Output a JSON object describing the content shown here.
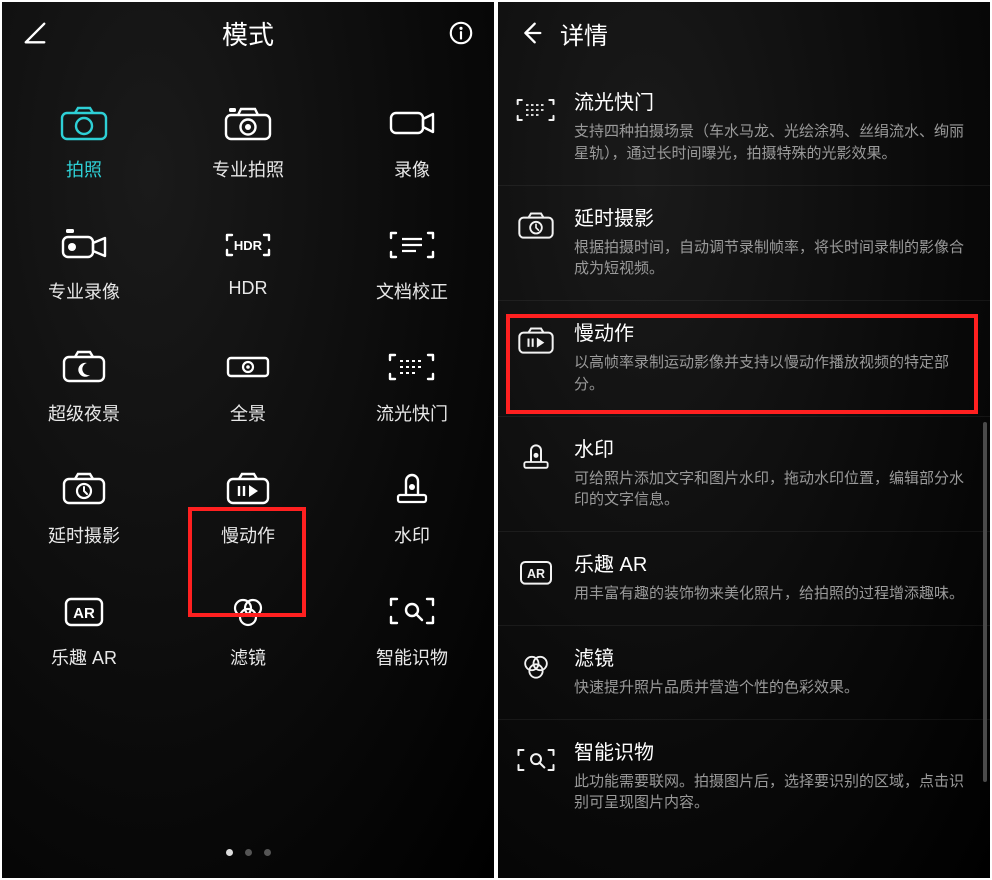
{
  "left": {
    "title": "模式",
    "modes": [
      {
        "icon": "camera",
        "label": "拍照",
        "active": true
      },
      {
        "icon": "camera-pro",
        "label": "专业拍照"
      },
      {
        "icon": "video",
        "label": "录像"
      },
      {
        "icon": "video-pro",
        "label": "专业录像"
      },
      {
        "icon": "hdr",
        "label": "HDR"
      },
      {
        "icon": "document",
        "label": "文档校正"
      },
      {
        "icon": "night",
        "label": "超级夜景"
      },
      {
        "icon": "panorama",
        "label": "全景"
      },
      {
        "icon": "light-paint",
        "label": "流光快门"
      },
      {
        "icon": "timelapse",
        "label": "延时摄影"
      },
      {
        "icon": "slowmo",
        "label": "慢动作",
        "highlighted": true
      },
      {
        "icon": "watermark",
        "label": "水印"
      },
      {
        "icon": "ar",
        "label": "乐趣 AR"
      },
      {
        "icon": "filter",
        "label": "滤镜"
      },
      {
        "icon": "object-detect",
        "label": "智能识物"
      }
    ],
    "page_dots": {
      "count": 3,
      "active": 0
    }
  },
  "right": {
    "title": "详情",
    "items": [
      {
        "icon": "light-paint",
        "title": "流光快门",
        "desc": "支持四种拍摄场景（车水马龙、光绘涂鸦、丝绢流水、绚丽星轨），通过长时间曝光，拍摄特殊的光影效果。"
      },
      {
        "icon": "timelapse",
        "title": "延时摄影",
        "desc": "根据拍摄时间，自动调节录制帧率，将长时间录制的影像合成为短视频。"
      },
      {
        "icon": "slowmo",
        "title": "慢动作",
        "desc": "以高帧率录制运动影像并支持以慢动作播放视频的特定部分。",
        "highlighted": true
      },
      {
        "icon": "watermark",
        "title": "水印",
        "desc": "可给照片添加文字和图片水印，拖动水印位置，编辑部分水印的文字信息。"
      },
      {
        "icon": "ar",
        "title": "乐趣 AR",
        "desc": "用丰富有趣的装饰物来美化照片，给拍照的过程增添趣味。"
      },
      {
        "icon": "filter",
        "title": "滤镜",
        "desc": "快速提升照片品质并营造个性的色彩效果。"
      },
      {
        "icon": "object-detect",
        "title": "智能识物",
        "desc": "此功能需要联网。拍摄图片后，选择要识别的区域，点击识别可呈现图片内容。"
      }
    ]
  }
}
